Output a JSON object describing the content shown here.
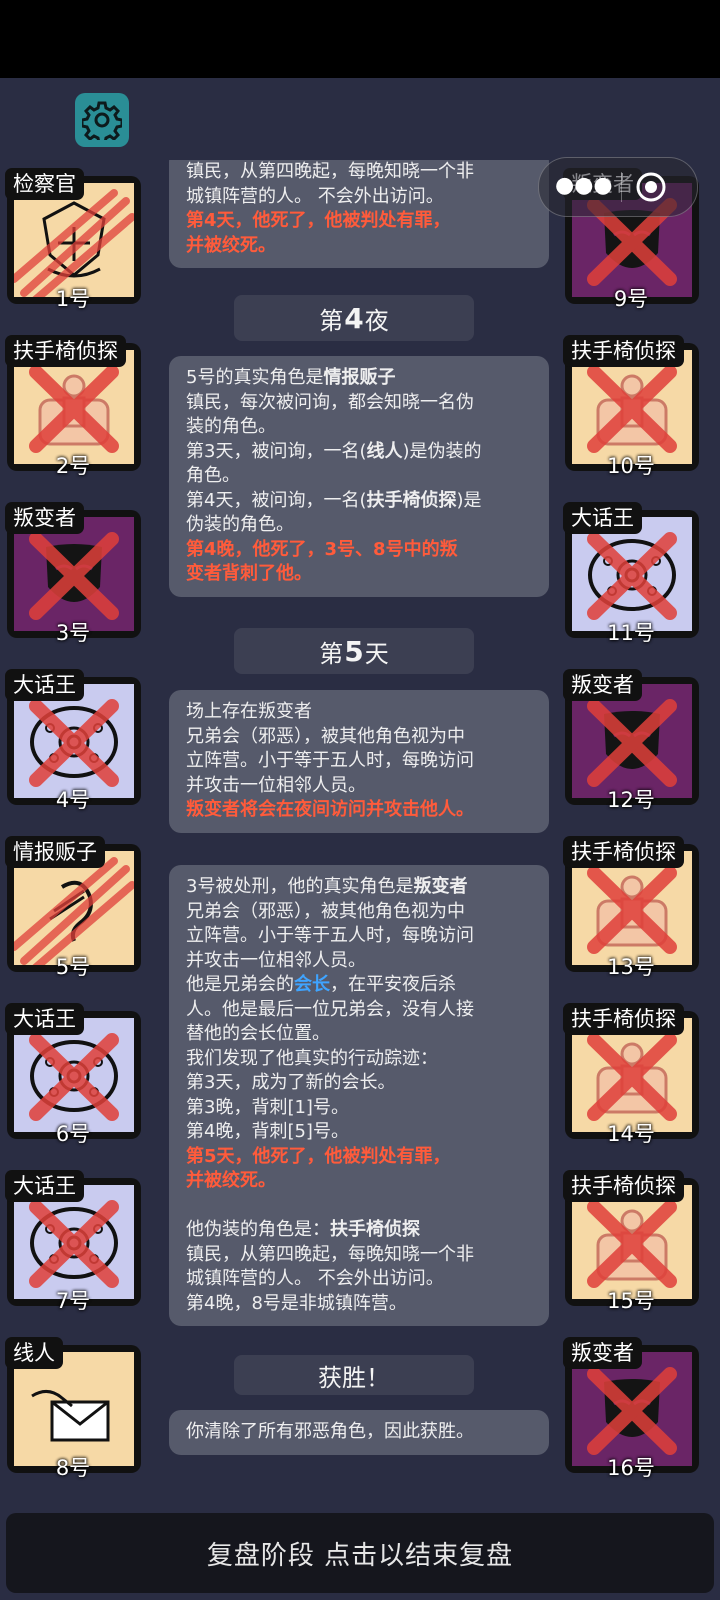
{
  "toolbar": {
    "settings_icon": "gear-icon",
    "more_icon": "more-dots-icon",
    "close_icon": "target-close-icon"
  },
  "colors": {
    "cream": "#f6d9a6",
    "purple": "#6a2566",
    "lavender": "#c9cbef",
    "red_text": "#ff5b3b",
    "blue_text": "#3fa4ff"
  },
  "players_left": [
    {
      "role": "检察官",
      "num": "1号",
      "icon": "prosecutor-badge-icon"
    },
    {
      "role": "扶手椅侦探",
      "num": "2号",
      "icon": "armchair-detective-icon"
    },
    {
      "role": "叛变者",
      "num": "3号",
      "icon": "traitor-mask-icon"
    },
    {
      "role": "大话王",
      "num": "4号",
      "icon": "braggart-swirl-icon"
    },
    {
      "role": "情报贩子",
      "num": "5号",
      "icon": "informant-ear-icon"
    },
    {
      "role": "大话王",
      "num": "6号",
      "icon": "braggart-swirl-icon"
    },
    {
      "role": "大话王",
      "num": "7号",
      "icon": "braggart-swirl-icon"
    },
    {
      "role": "线人",
      "num": "8号",
      "icon": "snitch-envelope-icon"
    }
  ],
  "players_right": [
    {
      "role": "叛变者",
      "num": "9号",
      "icon": "traitor-mask-icon"
    },
    {
      "role": "扶手椅侦探",
      "num": "10号",
      "icon": "armchair-detective-icon"
    },
    {
      "role": "大话王",
      "num": "11号",
      "icon": "braggart-swirl-icon"
    },
    {
      "role": "叛变者",
      "num": "12号",
      "icon": "traitor-mask-icon"
    },
    {
      "role": "扶手椅侦探",
      "num": "13号",
      "icon": "armchair-detective-icon"
    },
    {
      "role": "扶手椅侦探",
      "num": "14号",
      "icon": "armchair-detective-icon"
    },
    {
      "role": "扶手椅侦探",
      "num": "15号",
      "icon": "armchair-detective-icon"
    },
    {
      "role": "叛变者",
      "num": "16号",
      "icon": "traitor-mask-icon"
    }
  ],
  "log": {
    "card0": {
      "l1": "镇民，从第四晚起，每晚知晓一个非",
      "l2": "城镇阵营的人。 不会外出访问。",
      "r1": "第4天，他死了，他被判处有罪，",
      "r2": "并被绞死。"
    },
    "h1": {
      "pre": "第",
      "num": "4",
      "post": "夜"
    },
    "card1": {
      "l1a": "5号的真实角色是",
      "l1b": "情报贩子",
      "l2": "镇民，每次被问询，都会知晓一名伪",
      "l3": "装的角色。",
      "l4a": "第3天，被问询，一名(",
      "l4b": "线人",
      "l4c": ")是伪装的",
      "l5": "角色。",
      "l6a": "第4天，被问询，一名(",
      "l6b": "扶手椅侦探",
      "l6c": ")是",
      "l7": "伪装的角色。",
      "r1": "第4晚，他死了，3号、8号中的叛",
      "r2": "变者背刺了他。"
    },
    "h2": {
      "pre": "第",
      "num": "5",
      "post": "天"
    },
    "card2": {
      "l1": "场上存在叛变者",
      "l2": "兄弟会（邪恶），被其他角色视为中",
      "l3": "立阵营。小于等于五人时，每晚访问",
      "l4": "并攻击一位相邻人员。",
      "r1": "叛变者将会在夜间访问并攻击他人。"
    },
    "card3": {
      "l1a": "3号被处刑，他的真实角色是",
      "l1b": "叛变者",
      "l2": "兄弟会（邪恶），被其他角色视为中",
      "l3": "立阵营。小于等于五人时，每晚访问",
      "l4": "并攻击一位相邻人员。",
      "l5a": "他是兄弟会的",
      "l5b": "会长",
      "l5c": "，在平安夜后杀",
      "l6": "人。他是最后一位兄弟会，没有人接",
      "l7": "替他的会长位置。",
      "l8": "我们发现了他真实的行动踪迹：",
      "l9": "第3天，成为了新的会长。",
      "l10": "第3晚，背刺[1]号。",
      "l11": "第4晚，背刺[5]号。",
      "r1": "第5天，他死了，他被判处有罪，",
      "r2": "并被绞死。",
      "l12a": "他伪装的角色是：",
      "l12b": "扶手椅侦探",
      "l13": "镇民，从第四晚起，每晚知晓一个非",
      "l14": "城镇阵营的人。 不会外出访问。",
      "l15": "第4晚，8号是非城镇阵营。"
    },
    "h3": {
      "text": "获胜！"
    },
    "card4": {
      "l1": "你清除了所有邪恶角色，因此获胜。"
    }
  },
  "bottom_bar": {
    "label": "复盘阶段 点击以结束复盘"
  }
}
